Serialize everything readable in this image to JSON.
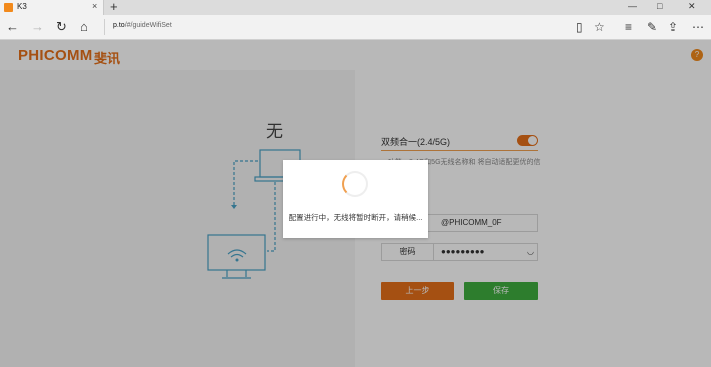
{
  "browser": {
    "tab_title": "K3",
    "tab_close": "×",
    "new_tab": "+",
    "address_host": "p.to",
    "address_path": "/#/guideWifiSet",
    "win_min": "—",
    "win_max": "□",
    "win_close": "✕"
  },
  "header": {
    "logo_en": "PHICOMM",
    "logo_cn": "斐讯",
    "help": "?"
  },
  "left": {
    "title": "无"
  },
  "form": {
    "dual_band_label": "双频合一(2.4/5G)",
    "dual_band_on": true,
    "description": "一功能，2.4G和5G无线名称和 将自动适配更优的信号",
    "ssid_value": "@PHICOMM_0F",
    "password_label": "密码",
    "password_value": "●●●●●●●●●",
    "prev_button": "上一步",
    "save_button": "保存"
  },
  "dialog": {
    "message": "配置进行中，无线将暂时断开，请稍候..."
  },
  "colors": {
    "accent": "#e5701a",
    "save": "#3fae3f",
    "illustration": "#4aa3c7"
  }
}
